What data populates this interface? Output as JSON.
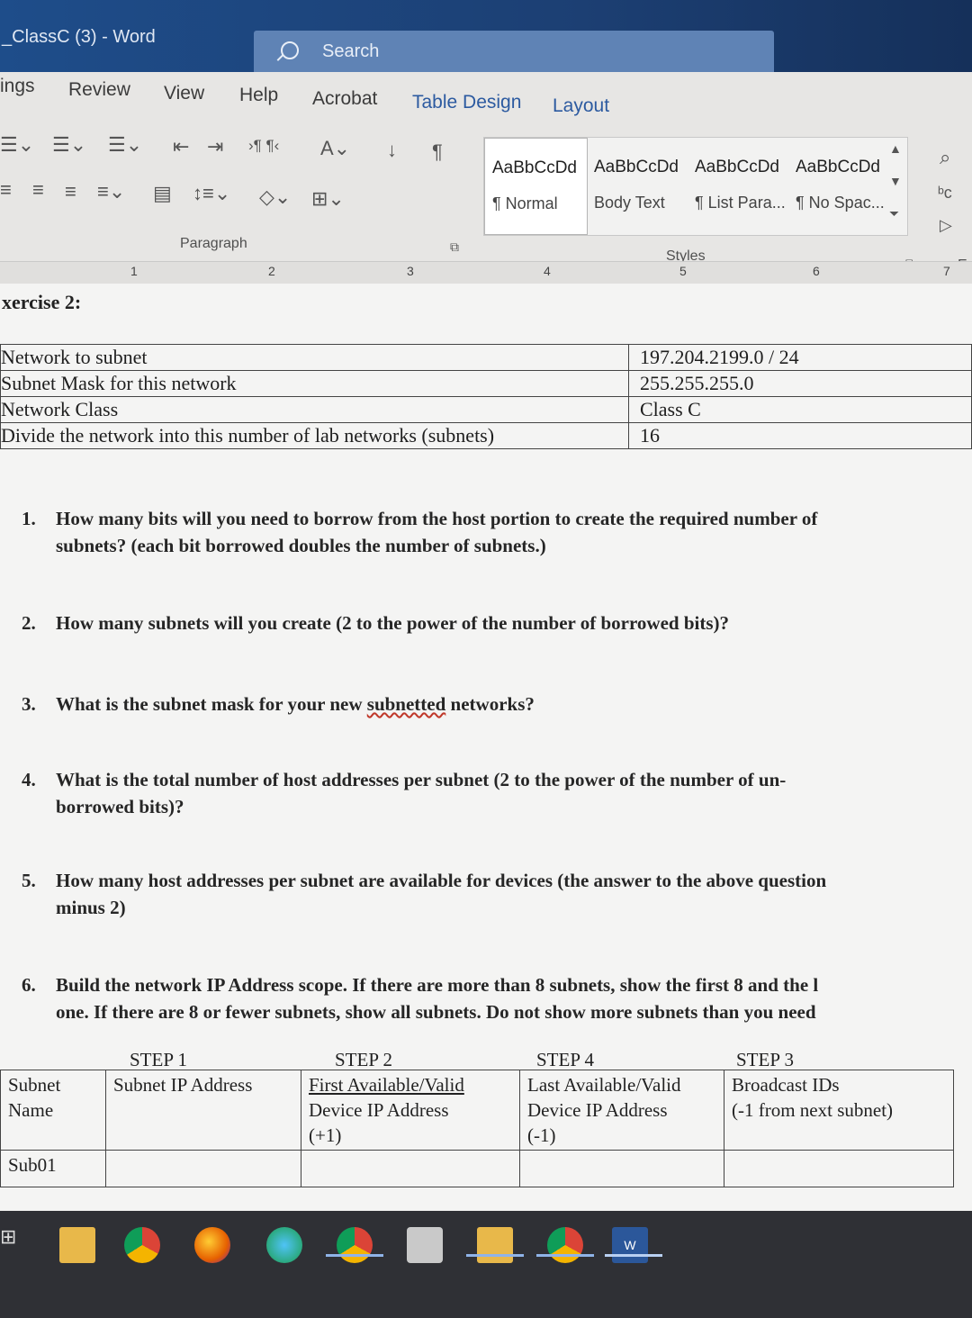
{
  "window": {
    "title": "_ClassC (3)  -  Word",
    "search_placeholder": "Search"
  },
  "tabs": [
    "ings",
    "Review",
    "View",
    "Help",
    "Acrobat",
    "Table Design",
    "Layout"
  ],
  "ribbon": {
    "paragraph_label": "Paragraph",
    "styles_label": "Styles",
    "styles": [
      {
        "sample": "AaBbCcDd",
        "name": "¶ Normal"
      },
      {
        "sample": "AaBbCcDd",
        "name": "Body Text"
      },
      {
        "sample": "AaBbCcDd",
        "name": "¶ List Para..."
      },
      {
        "sample": "AaBbCcDd",
        "name": "¶ No Spac..."
      }
    ],
    "editing_label": "Ec"
  },
  "ruler": [
    "1",
    "2",
    "3",
    "4",
    "5",
    "6",
    "7"
  ],
  "doc": {
    "heading": "xercise 2:",
    "info_table": [
      {
        "label": "Network to subnet",
        "value": "197.204.2199.0 / 24"
      },
      {
        "label": "Subnet Mask for this network",
        "value": "255.255.255.0"
      },
      {
        "label": "Network Class",
        "value": "Class C"
      },
      {
        "label": "Divide the network into this number of lab networks (subnets)",
        "value": "16"
      }
    ],
    "questions": [
      {
        "num": "1.",
        "l1": "How many bits will you need to borrow from the host portion to create the required number of",
        "l2": "subnets?  (each bit borrowed doubles the number of subnets.)"
      },
      {
        "num": "2.",
        "l1": "How many subnets will you create (2 to the power of the number of borrowed bits)?",
        "l2": ""
      },
      {
        "num": "3.",
        "l1a": "What is the subnet mask for your new ",
        "l1b": "subnetted",
        "l1c": " networks?"
      },
      {
        "num": "4.",
        "l1": "What is the total number of host addresses per subnet (2 to the power of the number of un-",
        "l2": "borrowed bits)?"
      },
      {
        "num": "5.",
        "l1": "How many host addresses per subnet are available for devices (the answer to the above question",
        "l2": "minus 2)"
      },
      {
        "num": "6.",
        "l1": "Build the network IP Address scope.  If there are more than 8 subnets, show the first 8 and the l",
        "l2": "one.  If there are 8 or fewer subnets, show all subnets.  Do not show more subnets than you need"
      }
    ],
    "steps": [
      "STEP 1",
      "STEP 2",
      "STEP 4",
      "STEP 3"
    ],
    "scope_table": {
      "headers": [
        [
          "Subnet",
          "Name"
        ],
        [
          "Subnet IP Address"
        ],
        [
          "First Available/Valid",
          "Device IP Address",
          "(+1)"
        ],
        [
          "Last Available/Valid",
          "Device IP Address",
          "(-1)"
        ],
        [
          "Broadcast IDs",
          "(-1 from next subnet)"
        ]
      ],
      "first_row": "Sub01"
    }
  },
  "taskbar": [
    "task-view",
    "file-explorer",
    "chrome",
    "firefox",
    "edge",
    "chrome-profile",
    "printer",
    "file-explorer-2",
    "chrome-2",
    "word"
  ]
}
